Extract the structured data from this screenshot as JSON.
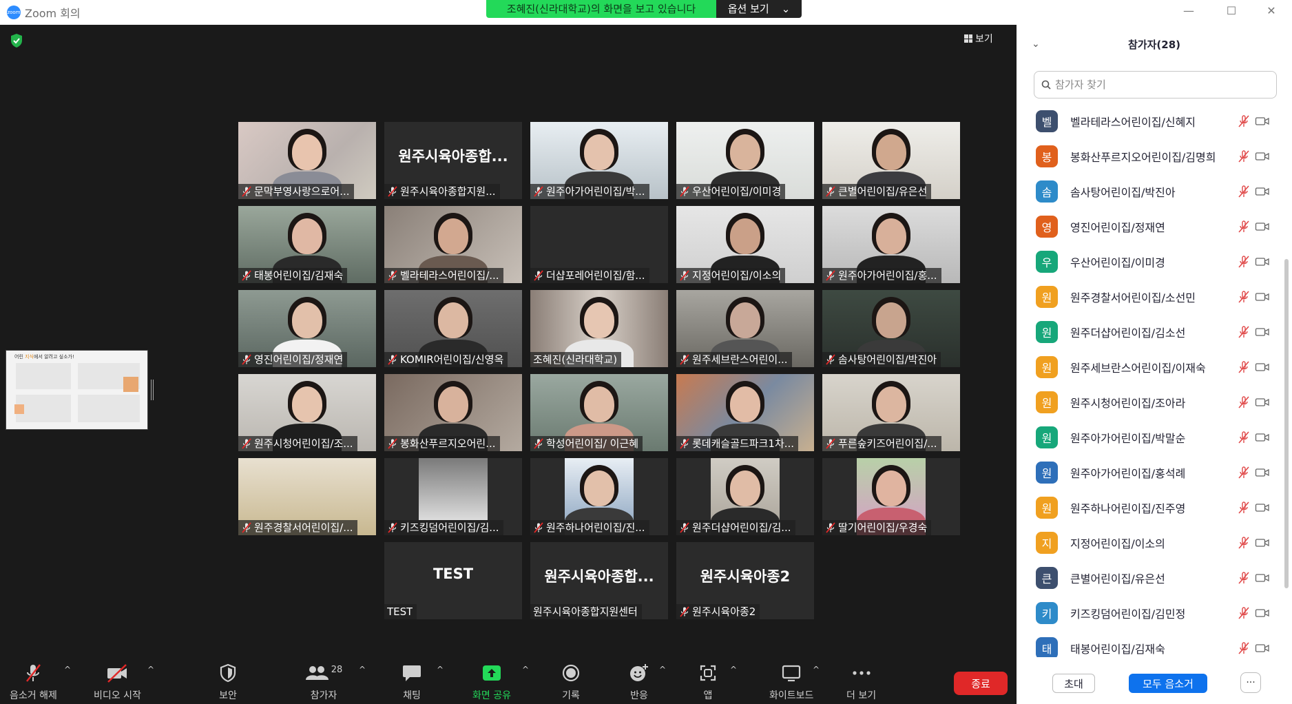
{
  "titlebar": {
    "app_title": "Zoom 회의",
    "logo_text": "zoom",
    "share_banner": "조혜진(신라대학교)의 화면을 보고 있습니다",
    "view_options": "옵션 보기",
    "minimize": "—",
    "maximize": "☐",
    "close": "✕"
  },
  "meeting": {
    "view_label": "보기",
    "thumbnail_title_pre": "어린 ",
    "thumbnail_title_hl": "지식",
    "thumbnail_title_post": "에서 알려고 싶소가!",
    "tiles": [
      {
        "name": "문막부영사랑으로어...",
        "muted": true
      },
      {
        "name": "원주시육아종합지원...",
        "muted": true,
        "big": "원주시육아종합..."
      },
      {
        "name": "원주아가어린이집/박...",
        "muted": true
      },
      {
        "name": "우산어린이집/이미경",
        "muted": true
      },
      {
        "name": "큰별어린이집/유은선",
        "muted": true
      },
      {
        "name": "태봉어린이집/김재숙",
        "muted": true
      },
      {
        "name": "벨라테라스어린이집/...",
        "muted": true
      },
      {
        "name": "더샵포레어린이집/함...",
        "muted": true
      },
      {
        "name": "지정어린이집/이소의",
        "muted": true
      },
      {
        "name": "원주아가어린이집/홍...",
        "muted": true
      },
      {
        "name": "영진어린이집/정재연",
        "muted": true
      },
      {
        "name": "KOMIR어린이집/신영옥",
        "muted": true
      },
      {
        "name": "조혜진(신라대학교)",
        "muted": false
      },
      {
        "name": "원주세브란스어린이...",
        "muted": true
      },
      {
        "name": "솜사탕어린이집/박진아",
        "muted": true
      },
      {
        "name": "원주시청어린이집/조...",
        "muted": true
      },
      {
        "name": "봉화산푸르지오어린...",
        "muted": true
      },
      {
        "name": "학성어린이집/ 이근혜",
        "muted": true
      },
      {
        "name": "롯데캐슬골드파크1차...",
        "muted": true
      },
      {
        "name": "푸른숲키즈어린이집/...",
        "muted": true
      },
      {
        "name": "원주경찰서어린이집/...",
        "muted": true
      },
      {
        "name": "키즈킹덤어린이집/김...",
        "muted": true
      },
      {
        "name": "원주하나어린이집/진...",
        "muted": true
      },
      {
        "name": "원주더샵어린이집/김...",
        "muted": true
      },
      {
        "name": "딸기어린이집/우경숙",
        "muted": true
      },
      {
        "name": "TEST",
        "muted": false,
        "big": "TEST"
      },
      {
        "name": "원주시육아종합지원센터",
        "muted": false,
        "big": "원주시육아종합..."
      },
      {
        "name": "원주시육아종2",
        "muted": true,
        "big": "원주시육아종2"
      }
    ]
  },
  "toolbar": {
    "unmute": "음소거 해제",
    "start_video": "비디오 시작",
    "security": "보안",
    "participants": "참가자",
    "participants_count": "28",
    "chat": "채팅",
    "share_screen": "화면 공유",
    "record": "기록",
    "reactions": "반응",
    "apps": "앱",
    "whiteboard": "화이트보드",
    "more": "더 보기",
    "end": "종료",
    "share_color": "#23d959",
    "end_color": "#e02828"
  },
  "panel": {
    "title": "참가자(28)",
    "search_placeholder": "참가자 찾기",
    "participants": [
      {
        "initial": "벨",
        "name": "벨라테라스어린이집/신혜지",
        "color": "#3d4f6e"
      },
      {
        "initial": "봉",
        "name": "봉화산푸르지오어린이집/김명희",
        "color": "#e0601c"
      },
      {
        "initial": "솜",
        "name": "솜사탕어린이집/박진아",
        "color": "#2e8bc9"
      },
      {
        "initial": "영",
        "name": "영진어린이집/정재연",
        "color": "#e0601c"
      },
      {
        "initial": "우",
        "name": "우산어린이집/이미경",
        "color": "#17a77a"
      },
      {
        "initial": "원",
        "name": "원주경찰서어린이집/소선민",
        "color": "#f0a020"
      },
      {
        "initial": "원",
        "name": "원주더샵어린이집/김소선",
        "color": "#17a77a"
      },
      {
        "initial": "원",
        "name": "원주세브란스어린이집/이재숙",
        "color": "#f0a020"
      },
      {
        "initial": "원",
        "name": "원주시청어린이집/조아라",
        "color": "#f0a020"
      },
      {
        "initial": "원",
        "name": "원주아가어린이집/박말순",
        "color": "#17a77a"
      },
      {
        "initial": "원",
        "name": "원주아가어린이집/홍석례",
        "color": "#2e6fb9"
      },
      {
        "initial": "원",
        "name": "원주하나어린이집/진주영",
        "color": "#f0a020"
      },
      {
        "initial": "지",
        "name": "지정어린이집/이소의",
        "color": "#f0a020"
      },
      {
        "initial": "큰",
        "name": "큰별어린이집/유은선",
        "color": "#3d4f6e"
      },
      {
        "initial": "키",
        "name": "키즈킹덤어린이집/김민정",
        "color": "#2e8bc9"
      },
      {
        "initial": "태",
        "name": "태봉어린이집/김재숙",
        "color": "#2e6fb9"
      }
    ],
    "invite": "초대",
    "mute_all": "모두 음소거",
    "more": "···"
  }
}
